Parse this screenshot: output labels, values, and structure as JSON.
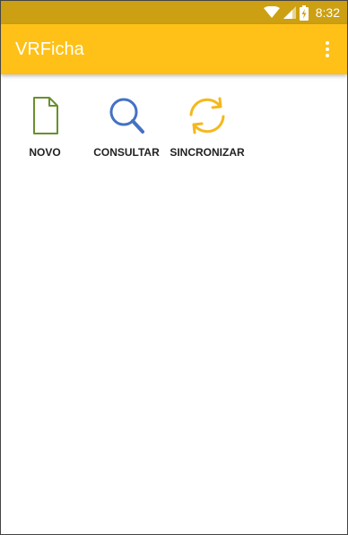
{
  "status_bar": {
    "time": "8:32",
    "battery_icon": "battery-charging-icon",
    "wifi_icon": "wifi-icon",
    "signal_icon": "cell-signal-icon",
    "color": "#CCA012"
  },
  "app_bar": {
    "title": "VRFicha",
    "menu_icon": "overflow-menu-icon",
    "color": "#FFC117"
  },
  "actions": [
    {
      "label": "NOVO",
      "icon": "new-document-icon",
      "color": "#6A8F2E"
    },
    {
      "label": "CONSULTAR",
      "icon": "search-icon",
      "color": "#4472C4"
    },
    {
      "label": "SINCRONIZAR",
      "icon": "sync-icon",
      "color": "#F5B81C"
    }
  ]
}
